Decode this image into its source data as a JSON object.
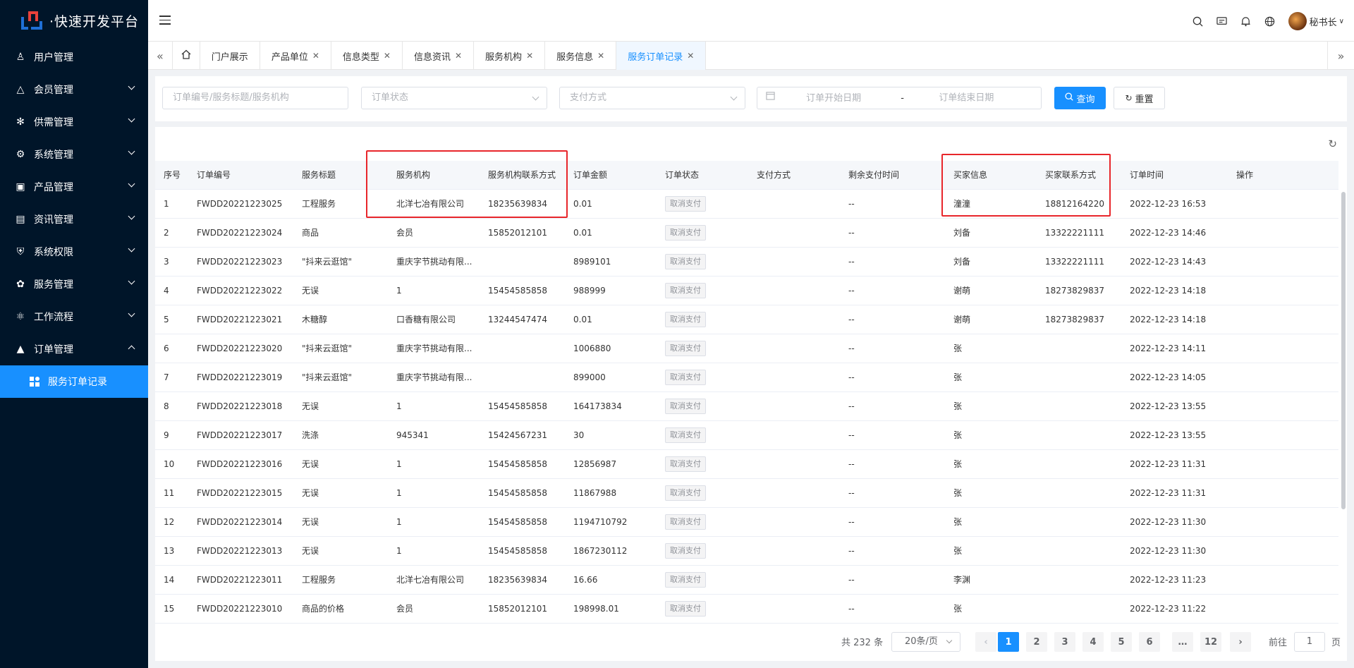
{
  "app": {
    "title": "·快速开发平台"
  },
  "sidebar": {
    "items": [
      {
        "label": "用户管理",
        "icon": "user-icon",
        "expandable": false
      },
      {
        "label": "会员管理",
        "icon": "member-icon",
        "expandable": true
      },
      {
        "label": "供需管理",
        "icon": "supply-icon",
        "expandable": true
      },
      {
        "label": "系统管理",
        "icon": "gear-icon",
        "expandable": true
      },
      {
        "label": "产品管理",
        "icon": "product-icon",
        "expandable": true
      },
      {
        "label": "资讯管理",
        "icon": "news-icon",
        "expandable": true
      },
      {
        "label": "系统权限",
        "icon": "shield-icon",
        "expandable": true
      },
      {
        "label": "服务管理",
        "icon": "service-icon",
        "expandable": true
      },
      {
        "label": "工作流程",
        "icon": "workflow-icon",
        "expandable": true
      },
      {
        "label": "订单管理",
        "icon": "order-icon",
        "expandable": true
      }
    ],
    "sub_active": {
      "label": "服务订单记录",
      "icon": "grid-icon"
    }
  },
  "header": {
    "user_name": "秘书长"
  },
  "tabs": [
    {
      "label": "门户展示",
      "closable": false
    },
    {
      "label": "产品单位",
      "closable": true
    },
    {
      "label": "信息类型",
      "closable": true
    },
    {
      "label": "信息资讯",
      "closable": true
    },
    {
      "label": "服务机构",
      "closable": true
    },
    {
      "label": "服务信息",
      "closable": true
    },
    {
      "label": "服务订单记录",
      "closable": true,
      "active": true
    }
  ],
  "filters": {
    "keyword_placeholder": "订单编号/服务标题/服务机构",
    "status_placeholder": "订单状态",
    "pay_placeholder": "支付方式",
    "start_date_placeholder": "订单开始日期",
    "date_separator": "-",
    "end_date_placeholder": "订单结束日期",
    "search_label": "查询",
    "reset_label": "重置"
  },
  "table": {
    "columns": [
      "序号",
      "订单编号",
      "服务标题",
      "服务机构",
      "服务机构联系方式",
      "订单金额",
      "订单状态",
      "支付方式",
      "剩余支付时间",
      "买家信息",
      "买家联系方式",
      "订单时间",
      "操作"
    ],
    "rows": [
      [
        "1",
        "FWDD20221223025",
        "工程服务",
        "北洋七冶有限公司",
        "18235639834",
        "0.01",
        "取消支付",
        "",
        "--",
        "潼潼",
        "18812164220",
        "2022-12-23 16:53"
      ],
      [
        "2",
        "FWDD20221223024",
        "商品",
        "会员",
        "15852012101",
        "0.01",
        "取消支付",
        "",
        "--",
        "刘备",
        "13322221111",
        "2022-12-23 14:46"
      ],
      [
        "3",
        "FWDD20221223023",
        "\"抖来云逛馆\"",
        "重庆字节挑动有限...",
        "",
        "8989101",
        "取消支付",
        "",
        "--",
        "刘备",
        "13322221111",
        "2022-12-23 14:43"
      ],
      [
        "4",
        "FWDD20221223022",
        "无误",
        "1",
        "15454585858",
        "988999",
        "取消支付",
        "",
        "--",
        "谢萌",
        "18273829837",
        "2022-12-23 14:18"
      ],
      [
        "5",
        "FWDD20221223021",
        "木糖醇",
        "口香糖有限公司",
        "13244547474",
        "0.01",
        "取消支付",
        "",
        "--",
        "谢萌",
        "18273829837",
        "2022-12-23 14:18"
      ],
      [
        "6",
        "FWDD20221223020",
        "\"抖来云逛馆\"",
        "重庆字节挑动有限...",
        "",
        "1006880",
        "取消支付",
        "",
        "--",
        "张",
        "",
        "2022-12-23 14:11"
      ],
      [
        "7",
        "FWDD20221223019",
        "\"抖来云逛馆\"",
        "重庆字节挑动有限...",
        "",
        "899000",
        "取消支付",
        "",
        "--",
        "张",
        "",
        "2022-12-23 14:05"
      ],
      [
        "8",
        "FWDD20221223018",
        "无误",
        "1",
        "15454585858",
        "164173834",
        "取消支付",
        "",
        "--",
        "张",
        "",
        "2022-12-23 13:55"
      ],
      [
        "9",
        "FWDD20221223017",
        "洗涤",
        "945341",
        "15424567231",
        "30",
        "取消支付",
        "",
        "--",
        "张",
        "",
        "2022-12-23 13:55"
      ],
      [
        "10",
        "FWDD20221223016",
        "无误",
        "1",
        "15454585858",
        "12856987",
        "取消支付",
        "",
        "--",
        "张",
        "",
        "2022-12-23 11:31"
      ],
      [
        "11",
        "FWDD20221223015",
        "无误",
        "1",
        "15454585858",
        "11867988",
        "取消支付",
        "",
        "--",
        "张",
        "",
        "2022-12-23 11:31"
      ],
      [
        "12",
        "FWDD20221223014",
        "无误",
        "1",
        "15454585858",
        "1194710792",
        "取消支付",
        "",
        "--",
        "张",
        "",
        "2022-12-23 11:30"
      ],
      [
        "13",
        "FWDD20221223013",
        "无误",
        "1",
        "15454585858",
        "1867230112",
        "取消支付",
        "",
        "--",
        "张",
        "",
        "2022-12-23 11:30"
      ],
      [
        "14",
        "FWDD20221223011",
        "工程服务",
        "北洋七冶有限公司",
        "18235639834",
        "16.66",
        "取消支付",
        "",
        "--",
        "李渊",
        "",
        "2022-12-23 11:23"
      ],
      [
        "15",
        "FWDD20221223010",
        "商品的价格",
        "会员",
        "15852012101",
        "198998.01",
        "取消支付",
        "",
        "--",
        "张",
        "",
        "2022-12-23 11:22"
      ]
    ]
  },
  "pagination": {
    "total": "共 232 条",
    "page_size": "20条/页",
    "pages": [
      "1",
      "2",
      "3",
      "4",
      "5",
      "6",
      "…",
      "12"
    ],
    "current": "1",
    "goto_label": "前往",
    "goto_value": "1",
    "page_suffix": "页"
  },
  "colors": {
    "primary": "#1890ff",
    "sidebar_bg": "#001529",
    "highlight_box": "#e8262b"
  }
}
